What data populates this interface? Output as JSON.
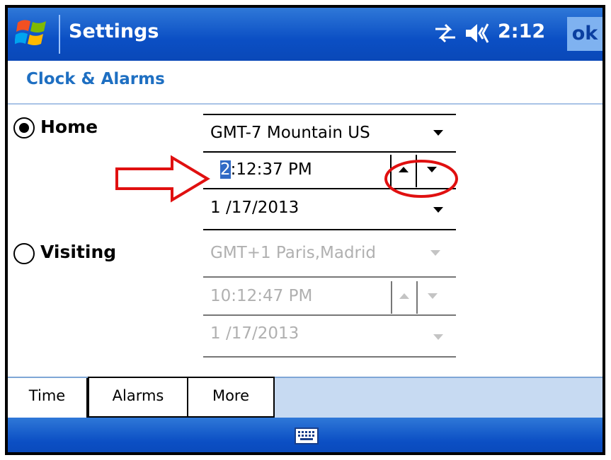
{
  "titlebar": {
    "title": "Settings",
    "time": "2:12",
    "ok_label": "ok",
    "icons": [
      "windows-logo",
      "connectivity-icon",
      "volume-icon"
    ]
  },
  "section": {
    "title": "Clock & Alarms"
  },
  "home": {
    "label": "Home",
    "selected": true,
    "timezone": "GMT-7 Mountain US",
    "time_highlight": "2",
    "time_rest": ":12:37 PM",
    "date": "1 /17/2013"
  },
  "visiting": {
    "label": "Visiting",
    "selected": false,
    "timezone": "GMT+1 Paris,Madrid",
    "time": "10:12:47 PM",
    "date": "1 /17/2013"
  },
  "tabs": [
    {
      "label": "Time",
      "active": true
    },
    {
      "label": "Alarms",
      "active": false
    },
    {
      "label": "More",
      "active": false
    }
  ],
  "bottombar": {
    "icon": "keyboard-icon"
  },
  "colors": {
    "titlebar": "#0b4fc4",
    "section_title": "#1e6fc2",
    "annotation": "#e01010",
    "disabled_text": "#b0b0b0"
  }
}
